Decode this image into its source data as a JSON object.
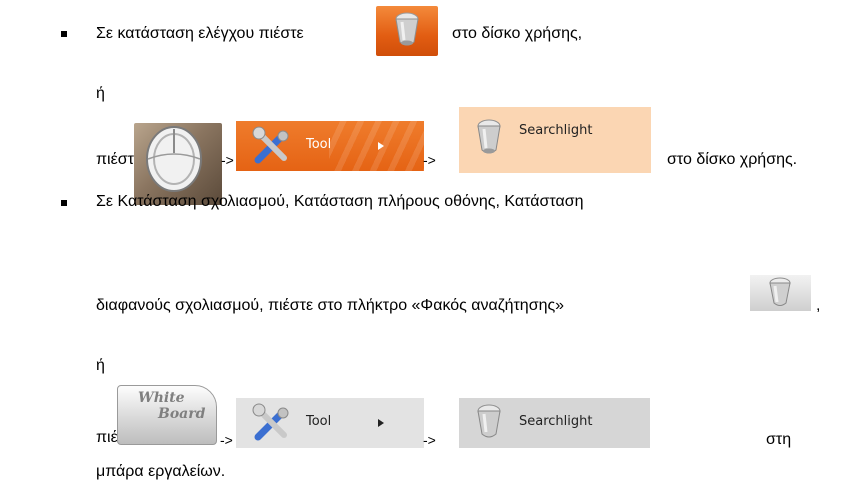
{
  "line1_text": "Σε κατάσταση ελέγχου πιέστε",
  "line1_suffix": "στο δίσκο χρήσης,",
  "or_1": "ή",
  "press_1": "πιέστε",
  "arrow_1a": "->",
  "arrow_1b": "->",
  "tool_menu_label_1": "Tool",
  "searchlight_label_1": "Searchlight",
  "line3_suffix": "στο δίσκο χρήσης.",
  "line4_text": "Σε Κατάσταση σχολιασμού, Κατάσταση πλήρους οθόνης, Κατάσταση",
  "line5_text": "διαφανούς σχολιασμού, πιέστε στο πλήκτρο «Φακός αναζήτησης»",
  "line5_comma": ",",
  "or_2": "ή",
  "press_2": "πιέστε",
  "whiteboard_line1": "White",
  "whiteboard_line2": "Board",
  "arrow_2a": "->",
  "arrow_2b": "->",
  "tool_menu_label_2": "Tool",
  "searchlight_label_2": "Searchlight",
  "line7_suffix": "στη",
  "line8_text": "μπάρα εργαλείων.",
  "colors": {
    "orange": "#e56314",
    "peach": "#fbd6b3",
    "gray": "#e3e3e3"
  }
}
